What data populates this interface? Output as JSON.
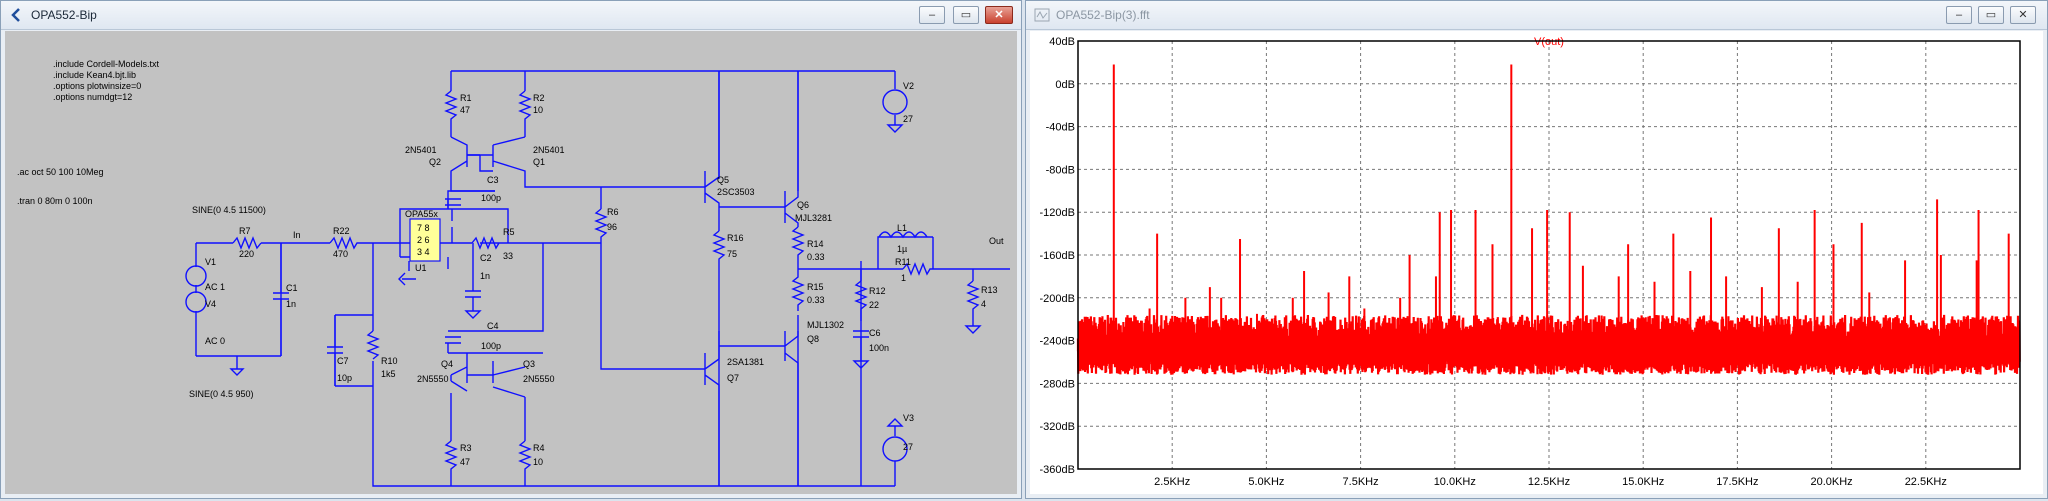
{
  "left_window": {
    "title": "OPA552-Bip",
    "directives": [
      ".include Cordell-Models.txt",
      ".include Kean4.bjt.lib",
      ".options plotwinsize=0",
      ".options numdgt=12"
    ],
    "ac_directive": ".ac oct 50 100 10Meg",
    "tran_directive": ".tran 0 80m 0 100n",
    "src_v1": "SINE(0 4.5 11500)",
    "src_v4": "SINE(0 4.5 950)",
    "v1": "V1",
    "v1_ac": "AC 1",
    "v4": "V4",
    "v4_ac": "AC 0",
    "r7": "R7",
    "r7v": "220",
    "net_in": "In",
    "r22": "R22",
    "r22v": "470",
    "c1": "C1",
    "c1v": "1n",
    "c7": "C7",
    "c7v": "10p",
    "r10": "R10",
    "r10v": "1k5",
    "u1": "U1",
    "u1_part": "OPA55x",
    "u1_pins": [
      "7 8",
      "2 6",
      "3 4"
    ],
    "c2": "C2",
    "c2v": "1n",
    "r5": "R5",
    "r5v": "33",
    "c3": "C3",
    "c3v": "100p",
    "c4": "C4",
    "c4v": "100p",
    "r1": "R1",
    "r1v": "47",
    "r2": "R2",
    "r2v": "10",
    "q2": "Q2",
    "q2p": "2N5401",
    "q1": "Q1",
    "q1p": "2N5401",
    "q4": "Q4",
    "q4p": "2N5550",
    "q3": "Q3",
    "q3p": "2N5550",
    "r3": "R3",
    "r3v": "47",
    "r4": "R4",
    "r4v": "10",
    "r6": "R6",
    "r6v": "96",
    "q5": "Q5",
    "q5p": "2SC3503",
    "q7": "Q7",
    "q7p": "2SA1381",
    "r16": "R16",
    "r16v": "75",
    "q6": "Q6",
    "q6p": "MJL3281",
    "q8": "Q8",
    "q8p": "MJL1302",
    "r14": "R14",
    "r14v": "0.33",
    "r15": "R15",
    "r15v": "0.33",
    "l1": "L1",
    "l1v": "1µ",
    "r11": "R11",
    "r11v": "1",
    "r12": "R12",
    "r12v": "22",
    "c6": "C6",
    "c6v": "100n",
    "r13": "R13",
    "r13v": "4",
    "net_out": "Out",
    "v2": "V2",
    "v2v": "27",
    "v3": "V3",
    "v3v": "27"
  },
  "right_window": {
    "title": "OPA552-Bip(3).fft"
  },
  "chart_data": {
    "type": "line",
    "title": "V(out)",
    "xlabel": "",
    "ylabel": "",
    "x_tick_labels": [
      "2.5KHz",
      "5.0KHz",
      "7.5KHz",
      "10.0KHz",
      "12.5KHz",
      "15.0KHz",
      "17.5KHz",
      "20.0KHz",
      "22.5KHz"
    ],
    "y_tick_labels": [
      "40dB",
      "0dB",
      "-40dB",
      "-80dB",
      "-120dB",
      "-160dB",
      "-200dB",
      "-240dB",
      "-280dB",
      "-320dB",
      "-360dB"
    ],
    "xlim": [
      0,
      25000
    ],
    "ylim": [
      -360,
      40
    ],
    "grid": true,
    "series": [
      {
        "color": "#ff0000",
        "noise_floor": -250,
        "peaks": [
          [
            950,
            18
          ],
          [
            1900,
            -210
          ],
          [
            2850,
            -200
          ],
          [
            3800,
            -200
          ],
          [
            4750,
            -215
          ],
          [
            5700,
            -200
          ],
          [
            6650,
            -195
          ],
          [
            7600,
            -210
          ],
          [
            8550,
            -200
          ],
          [
            9500,
            -180
          ],
          [
            10550,
            -118
          ],
          [
            9600,
            -120
          ],
          [
            11500,
            18
          ],
          [
            12450,
            -118
          ],
          [
            13400,
            -170
          ],
          [
            14350,
            -180
          ],
          [
            15300,
            -185
          ],
          [
            16250,
            -175
          ],
          [
            17200,
            -180
          ],
          [
            18150,
            -190
          ],
          [
            19100,
            -185
          ],
          [
            20050,
            -150
          ],
          [
            21000,
            -195
          ],
          [
            21950,
            -165
          ],
          [
            22900,
            -160
          ],
          [
            23850,
            -165
          ],
          [
            2100,
            -140
          ],
          [
            4300,
            -145
          ],
          [
            8800,
            -160
          ],
          [
            9900,
            -118
          ],
          [
            12050,
            -135
          ],
          [
            13050,
            -120
          ],
          [
            14600,
            -150
          ],
          [
            16800,
            -125
          ],
          [
            19550,
            -118
          ],
          [
            20800,
            -130
          ],
          [
            22800,
            -108
          ],
          [
            23900,
            -118
          ],
          [
            24700,
            -140
          ],
          [
            6000,
            -175
          ],
          [
            7200,
            -180
          ],
          [
            18600,
            -135
          ],
          [
            15800,
            -140
          ],
          [
            3500,
            -190
          ],
          [
            11000,
            -150
          ]
        ]
      }
    ]
  }
}
